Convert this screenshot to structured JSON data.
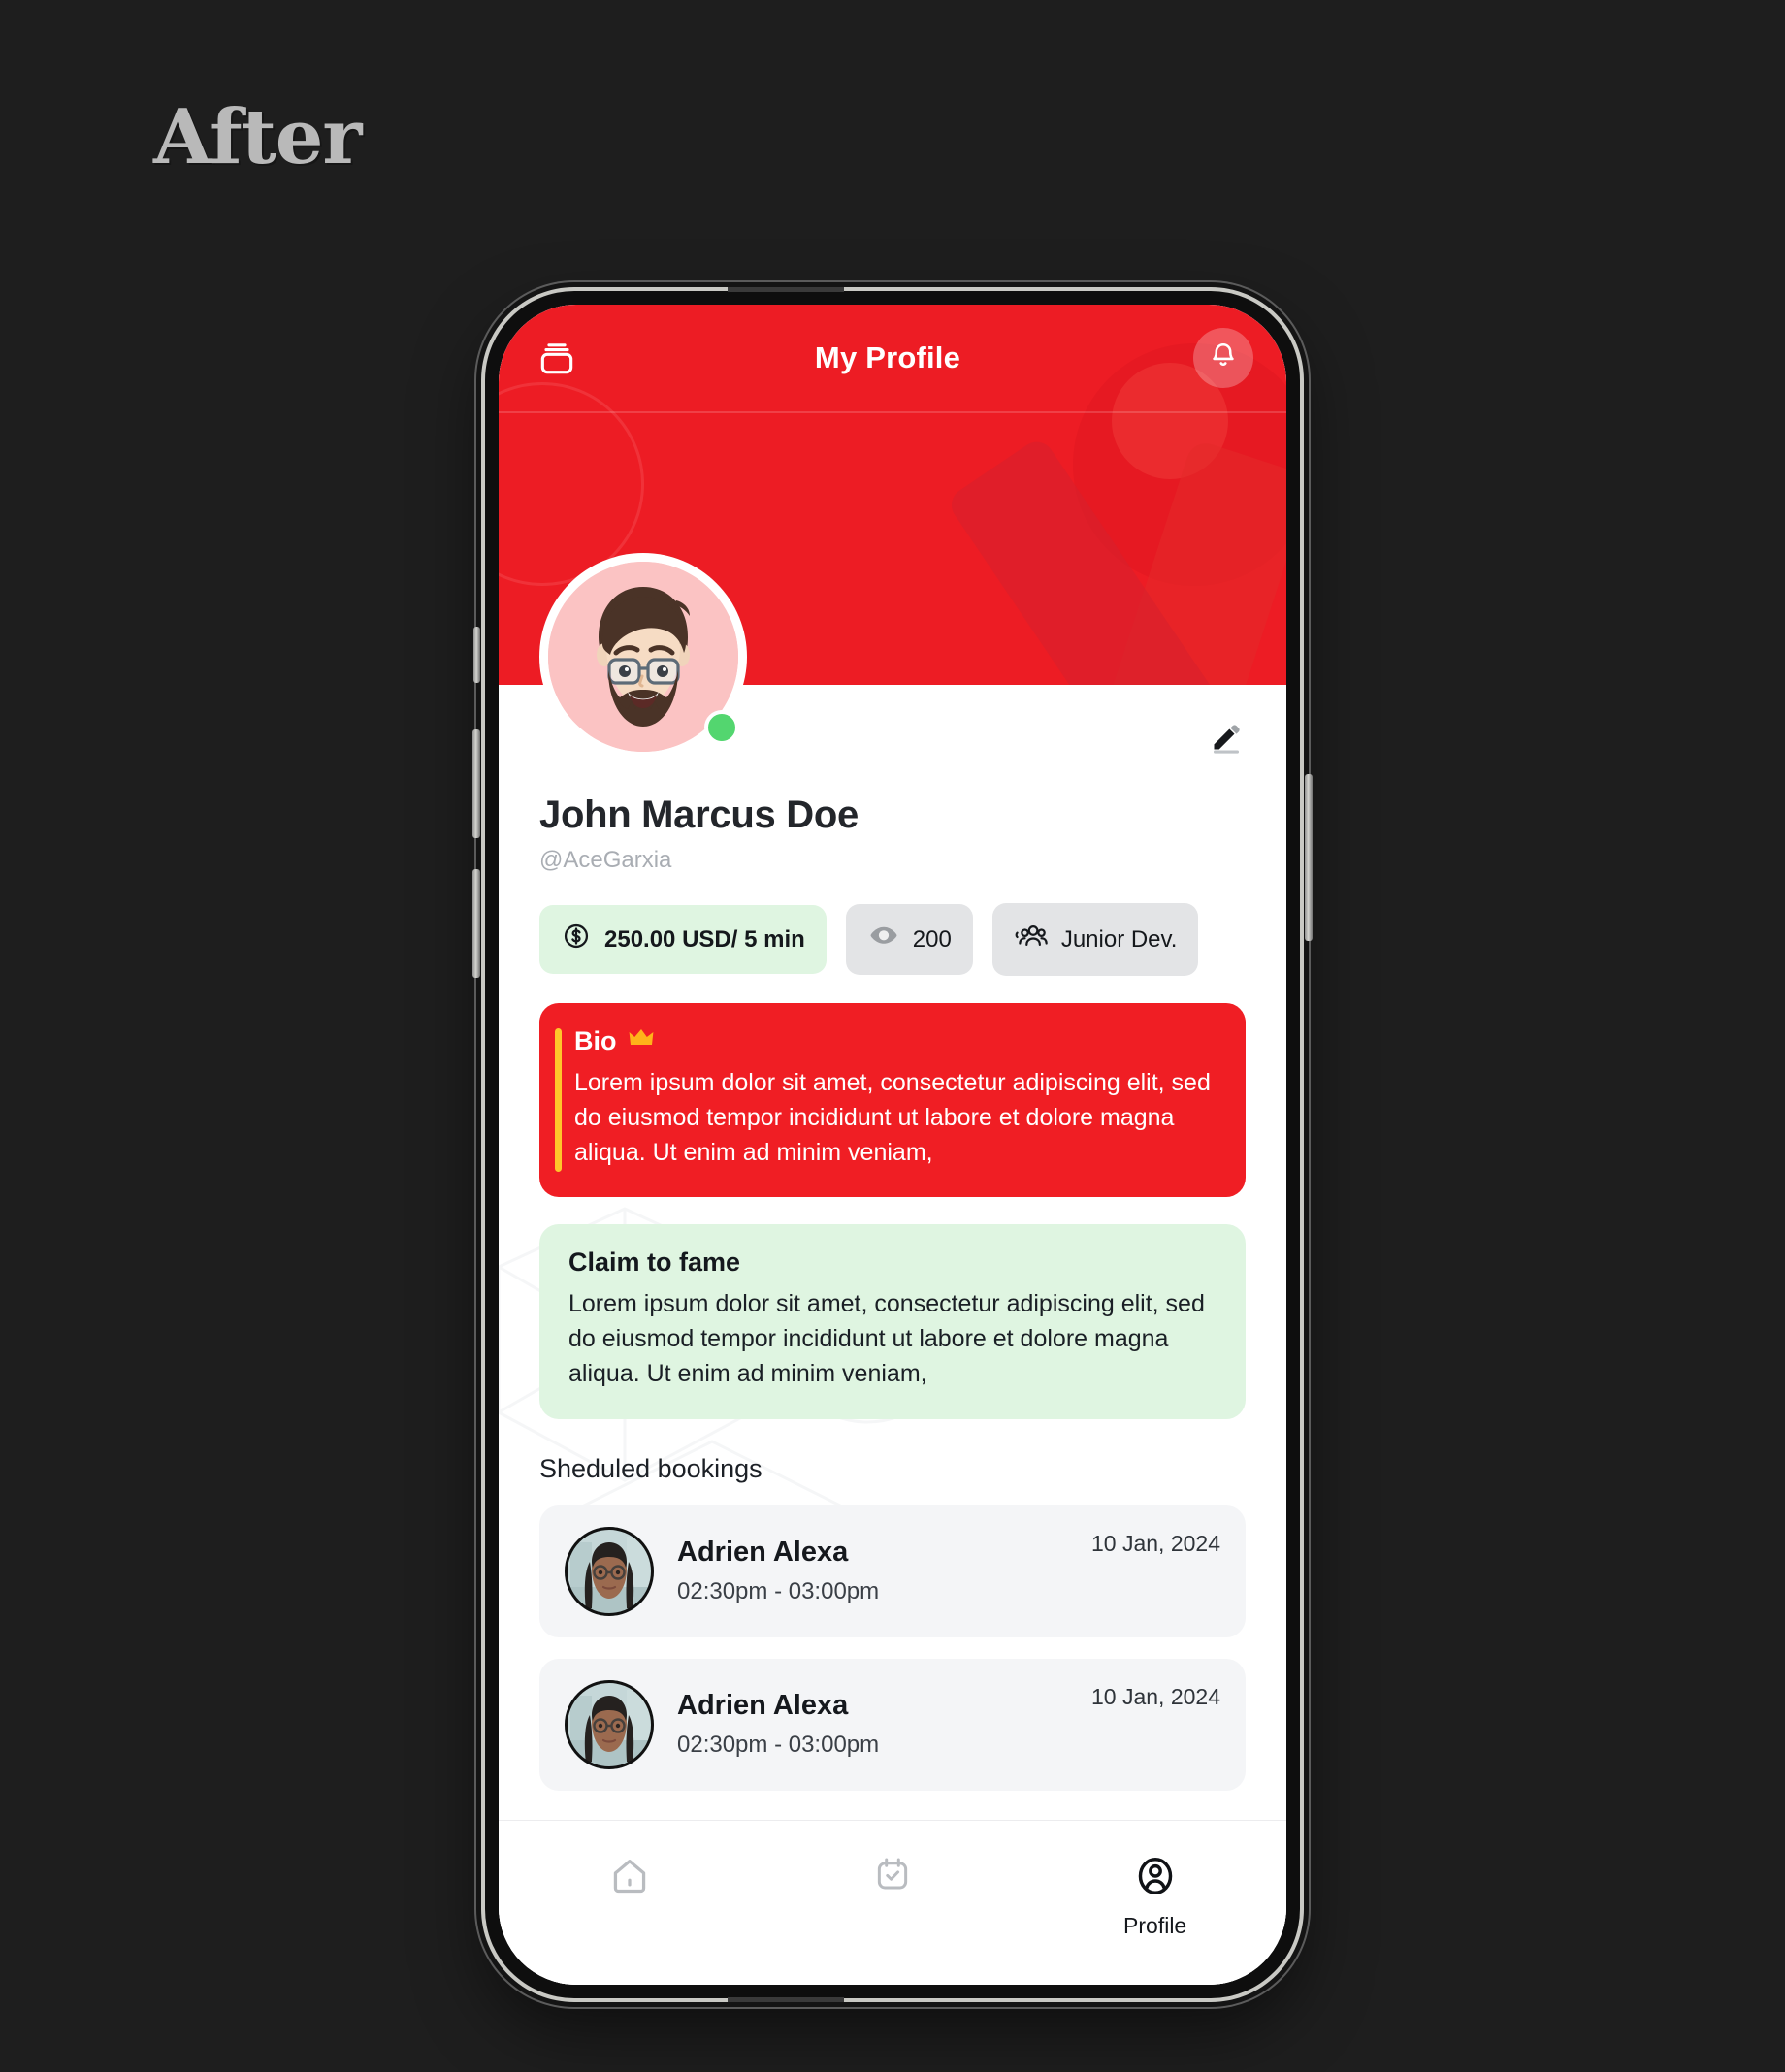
{
  "caption": {
    "text": "After"
  },
  "colors": {
    "brand_red": "#ED1C24",
    "bio_card_red": "#F01E24",
    "accent_yellow": "#FFC62B",
    "green_chip": "#dff5e1",
    "grey_chip": "#e3e4e6",
    "online_green": "#53d66f",
    "page_bg": "#1e1e1e"
  },
  "app": {
    "topbar": {
      "menu_icon": "card-stack-icon",
      "title": "My Profile",
      "notification_icon": "bell-icon"
    },
    "profile": {
      "avatar_icon": "memoji-avatar",
      "online_status": "online",
      "edit_icon": "pencil-icon",
      "name": "John Marcus Doe",
      "handle": "@AceGarxia",
      "chips": [
        {
          "id": "rate",
          "icon": "dollar-circle-icon",
          "label": "250.00 USD/ 5 min",
          "style": "green"
        },
        {
          "id": "views",
          "icon": "eye-icon",
          "label": "200",
          "style": "grey"
        },
        {
          "id": "role",
          "icon": "users-group-icon",
          "label": "Junior Dev.",
          "style": "grey"
        }
      ]
    },
    "bio_card": {
      "title": "Bio",
      "badge_icon": "crown-icon",
      "badge_glyph": "♛",
      "text": "Lorem ipsum dolor sit amet, consectetur adipiscing elit, sed do eiusmod tempor incididunt ut labore et dolore magna aliqua. Ut enim ad minim veniam,"
    },
    "fame_card": {
      "title": "Claim to fame",
      "text": "Lorem ipsum dolor sit amet, consectetur adipiscing elit, sed do eiusmod tempor incididunt ut labore et dolore magna aliqua. Ut enim ad minim veniam,"
    },
    "bookings": {
      "section_title": "Sheduled bookings",
      "items": [
        {
          "name": "Adrien Alexa",
          "time": "02:30pm -  03:00pm",
          "date": "10 Jan, 2024"
        },
        {
          "name": "Adrien Alexa",
          "time": "02:30pm -  03:00pm",
          "date": "10 Jan, 2024"
        }
      ]
    },
    "bottom_nav": {
      "items": [
        {
          "id": "home",
          "icon": "home-icon",
          "label": "",
          "active": false
        },
        {
          "id": "bookings",
          "icon": "calendar-check-icon",
          "label": "",
          "active": false
        },
        {
          "id": "profile",
          "icon": "person-circle-icon",
          "label": "Profile",
          "active": true
        }
      ]
    }
  }
}
